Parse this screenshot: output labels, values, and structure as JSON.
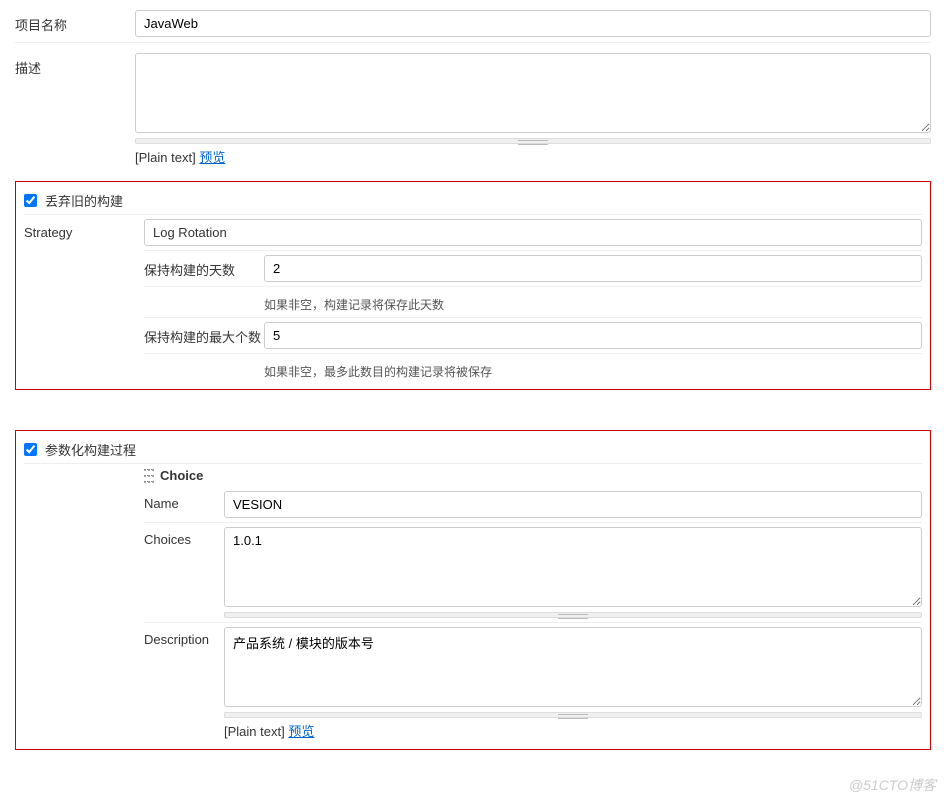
{
  "project_name": {
    "label": "项目名称",
    "value": "JavaWeb"
  },
  "description": {
    "label": "描述",
    "value": "",
    "plain_text": "[Plain text]",
    "preview": "预览"
  },
  "discard_old": {
    "label": "丢弃旧的构建",
    "checked": true,
    "strategy_label": "Strategy",
    "strategy_value": "Log Rotation",
    "days_to_keep": {
      "label": "保持构建的天数",
      "value": "2",
      "help": "如果非空，构建记录将保存此天数"
    },
    "max_to_keep": {
      "label": "保持构建的最大个数",
      "value": "5",
      "help": "如果非空，最多此数目的构建记录将被保存"
    }
  },
  "parameterized": {
    "label": "参数化构建过程",
    "checked": true,
    "choice_header": "Choice",
    "name": {
      "label": "Name",
      "value": "VESION"
    },
    "choices": {
      "label": "Choices",
      "value": "1.0.1"
    },
    "description": {
      "label": "Description",
      "value": "产品系统 / 模块的版本号",
      "plain_text": "[Plain text]",
      "preview": "预览"
    }
  },
  "watermark": "@51CTO博客"
}
